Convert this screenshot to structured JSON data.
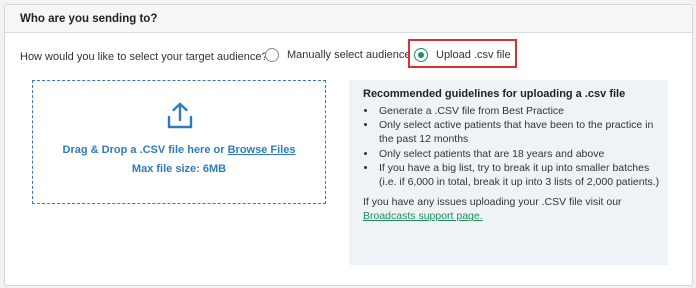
{
  "header": {
    "title": "Who are you sending to?"
  },
  "audience": {
    "question": "How would you like to select your target audience?",
    "options": [
      {
        "label": "Manually select audience",
        "selected": false
      },
      {
        "label": "Upload .csv file",
        "selected": true
      }
    ]
  },
  "dropzone": {
    "drag_text": "Drag & Drop a .CSV file here",
    "or_text": "or",
    "browse_label": "Browse Files",
    "max_size": "Max file size: 6MB",
    "icon": "upload-icon"
  },
  "guidelines": {
    "title": "Recommended guidelines for uploading a .csv file",
    "items": [
      "Generate a .CSV file from Best Practice",
      "Only select active patients that have been to the practice in the past 12 months",
      "Only select patients that are 18 years and above",
      "If you have a big list, try to break it up into smaller batches (i.e. if 6,000 in total, break it up into 3 lists of 2,000 patients.)"
    ],
    "footer_text": "If you have any issues uploading your .CSV file visit our",
    "support_link": "Broadcasts support page."
  },
  "colors": {
    "accent_blue": "#2f7bbf",
    "accent_green": "#1e8f5a",
    "highlight_red": "#e02d2d",
    "panel_bg": "#eef3f8"
  }
}
